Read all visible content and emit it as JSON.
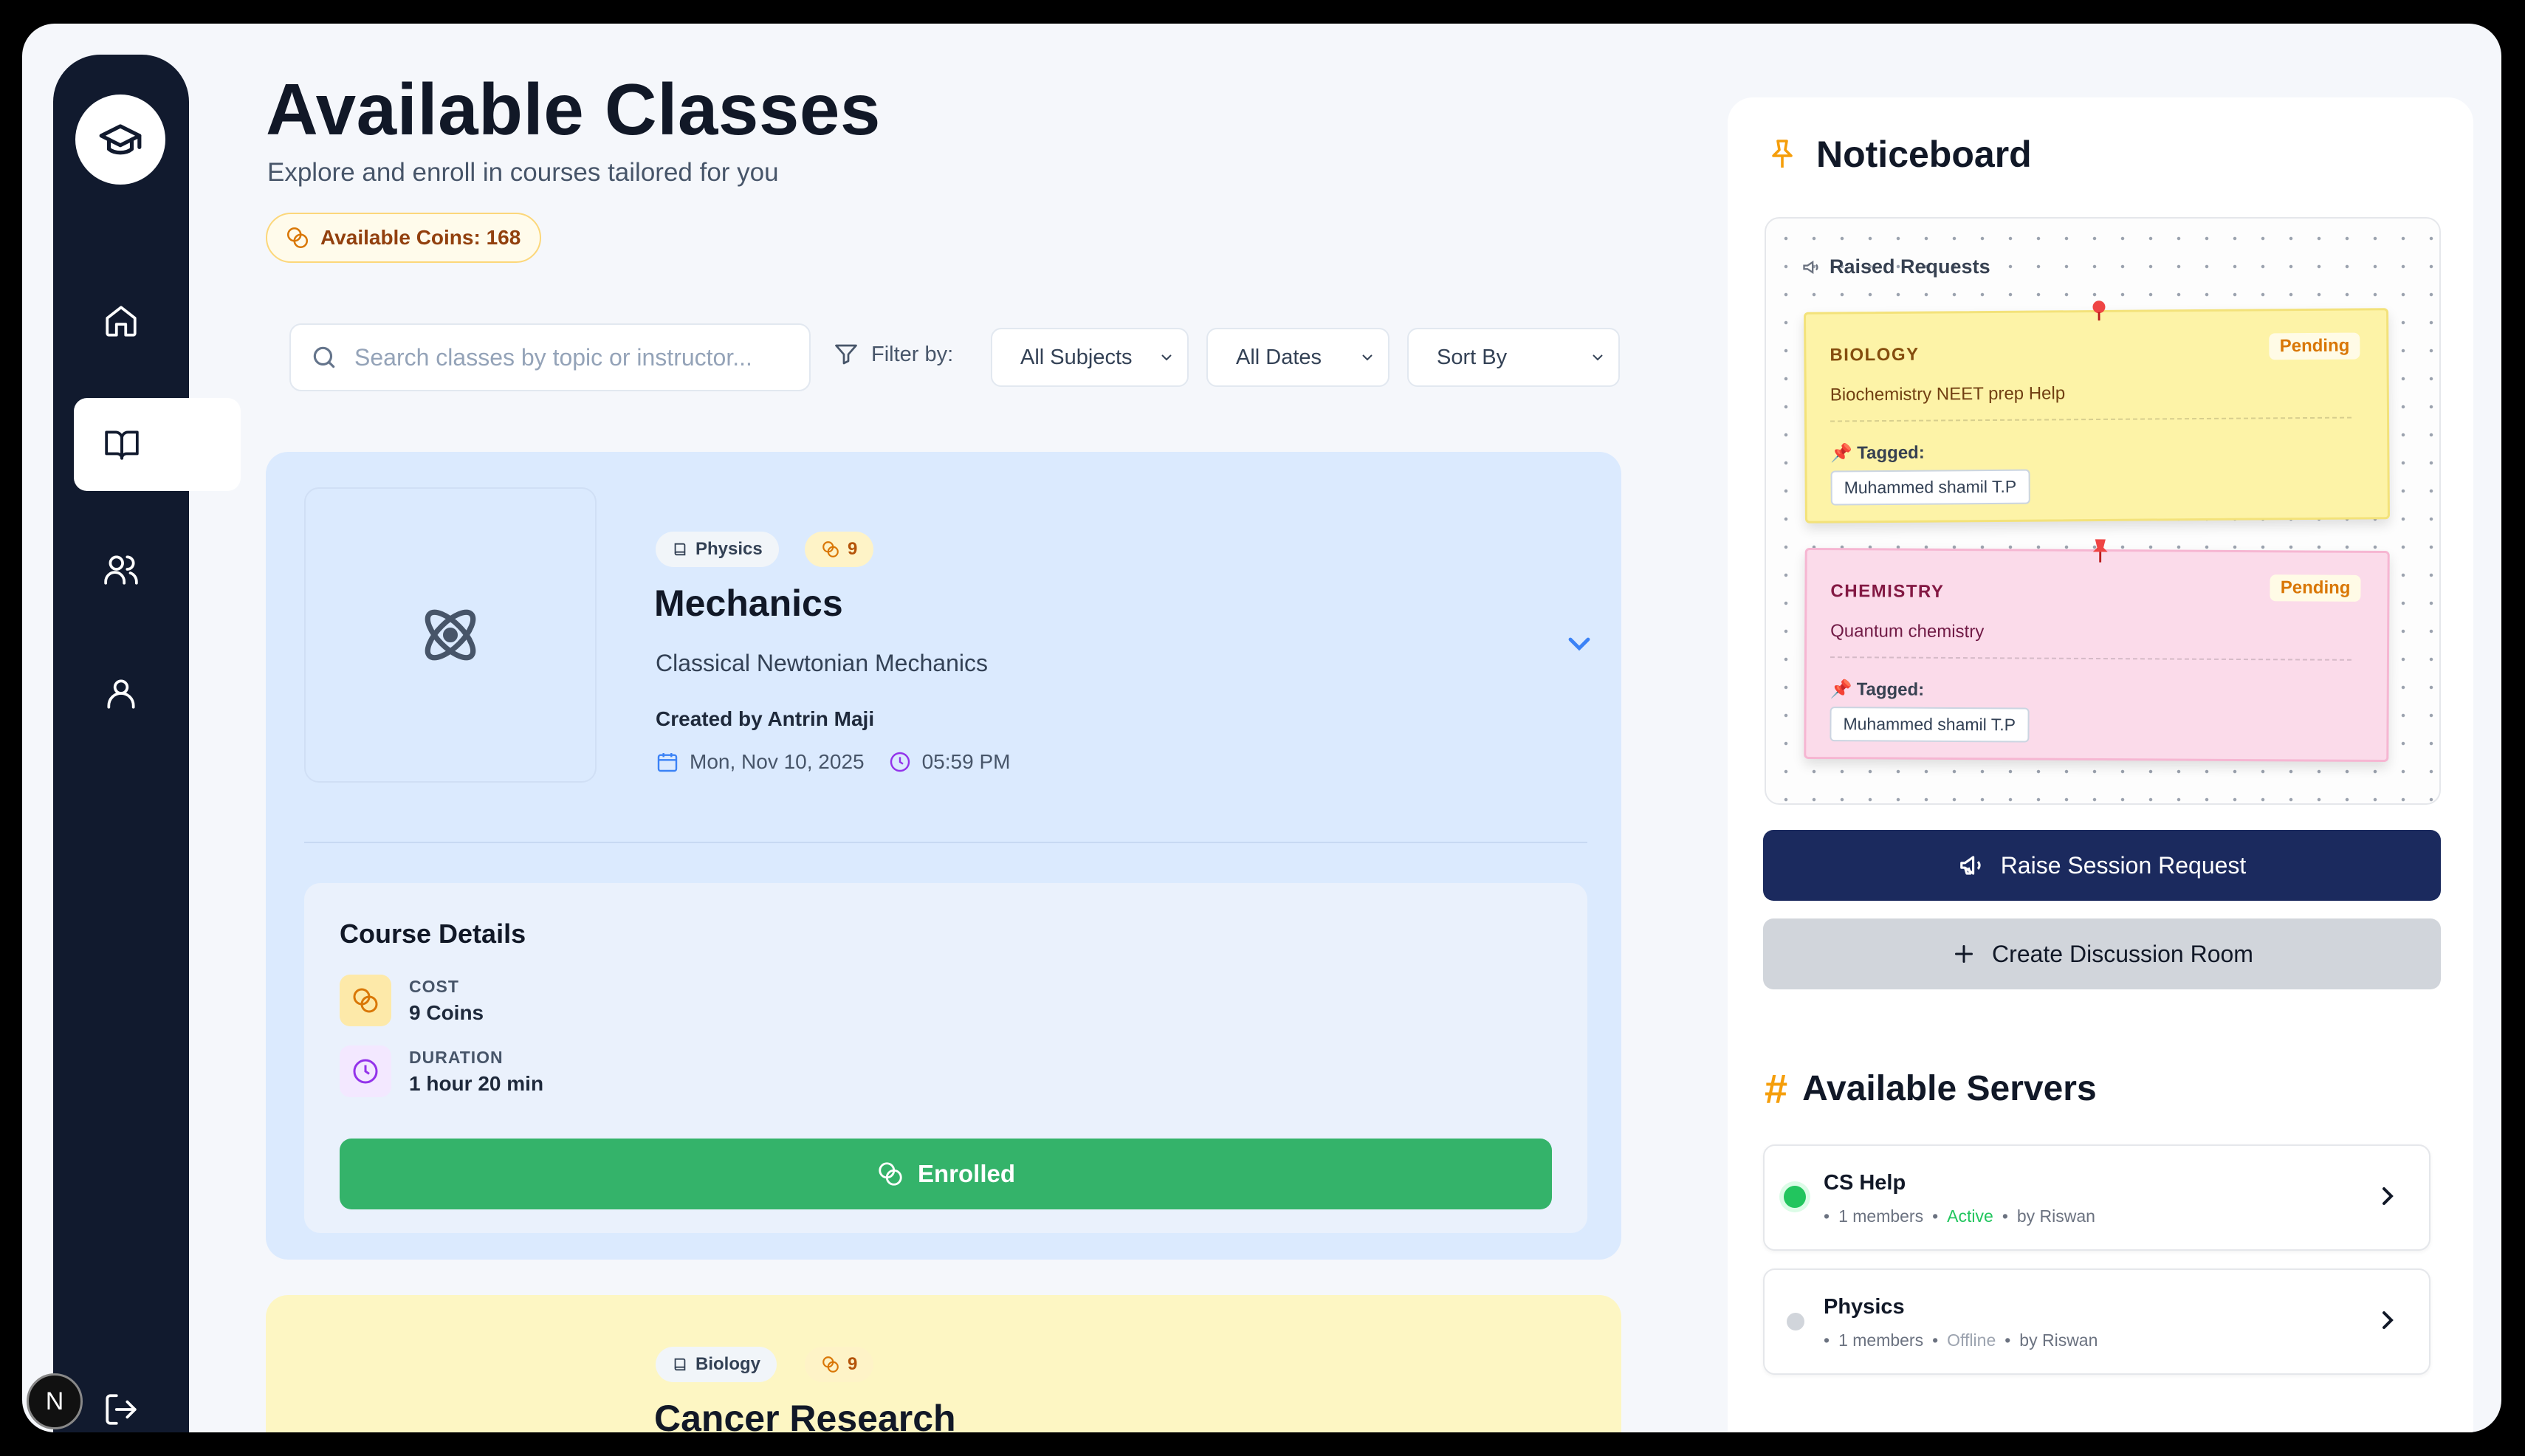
{
  "sidebar": {
    "logo_icon": "graduation-cap-icon",
    "items": [
      {
        "name": "home",
        "icon": "home-icon"
      },
      {
        "name": "classes",
        "icon": "book-open-icon",
        "active": true
      },
      {
        "name": "community",
        "icon": "users-icon"
      },
      {
        "name": "profile",
        "icon": "user-icon"
      }
    ],
    "logout_icon": "logout-icon",
    "badge_letter": "N"
  },
  "header": {
    "title": "Available Classes",
    "subtitle": "Explore and enroll in courses tailored for you",
    "coins_label": "Available Coins: 168"
  },
  "search": {
    "placeholder": "Search classes by topic or instructor..."
  },
  "filters": {
    "label": "Filter by:",
    "subjects": "All Subjects",
    "dates": "All Dates",
    "sort": "Sort By"
  },
  "classes": [
    {
      "subject": "Physics",
      "cost_badge": "9",
      "title": "Mechanics",
      "description": "Classical Newtonian Mechanics",
      "creator": "Created by Antrin Maji",
      "date": "Mon, Nov 10, 2025",
      "time": "05:59 PM",
      "details": {
        "heading": "Course Details",
        "cost_label": "COST",
        "cost_value": "9 Coins",
        "duration_label": "DURATION",
        "duration_value": "1 hour 20 min",
        "action": "Enrolled"
      }
    },
    {
      "subject": "Biology",
      "cost_badge": "9",
      "title": "Cancer Research"
    }
  ],
  "noticeboard": {
    "title": "Noticeboard",
    "section_label": "Raised Requests",
    "notes": [
      {
        "subject": "BIOLOGY",
        "status": "Pending",
        "topic": "Biochemistry NEET prep Help",
        "tagged_label": "Tagged:",
        "person": "Muhammed shamil T.P"
      },
      {
        "subject": "CHEMISTRY",
        "status": "Pending",
        "topic": "Quantum chemistry",
        "tagged_label": "Tagged:",
        "person": "Muhammed shamil T.P"
      }
    ],
    "raise_button": "Raise Session Request",
    "create_button": "Create Discussion Room"
  },
  "servers": {
    "title": "Available Servers",
    "items": [
      {
        "name": "CS Help",
        "members": "1 members",
        "status": "Active",
        "owner": "by Riswan",
        "status_color": "#22c55e"
      },
      {
        "name": "Physics",
        "members": "1 members",
        "status": "Offline",
        "owner": "by Riswan",
        "status_color": "#d1d5db"
      }
    ]
  },
  "colors": {
    "accent": "#1b2a5e",
    "success": "#34b36a",
    "coin": "#d97706",
    "sidebar": "#111a2e"
  }
}
